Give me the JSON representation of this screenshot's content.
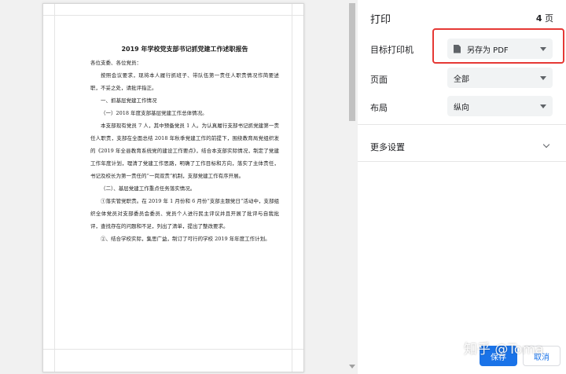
{
  "preview": {
    "document": {
      "title": "2019 年学校党支部书记抓党建工作述职报告",
      "paragraphs": [
        "各位支委、各位党员：",
        "按照会议要求，现将本人履行抓班子、带队伍第一责任人职责情况作简要述职，不妥之处，请批评指正。",
        "一、抓基层党建工作情况",
        "（一）2018 年度支部基层党建工作总体情况。",
        "本支部现有党员 7 人，其中预备党员 1 人。为认真履行支部书记抓党建第一责任人职责，支部在全面总结 2018 年秋季党建工作的前提下，围绕教育局党组织发的《2019 年全县教育系统党的建设工作要点》，结合本支部实际情况，制定了党建工作年度计划，理清了党建工作思路，明确了工作目标和方向，落实了主体责任，书记及校长为第一责任的“一岗双责”机制，支部党建工作有序开展。",
        "（二）、基层党建工作重点任务落实情况。",
        "①落实管党职责。在 2019 年 1 月份和 6 月份“支部主题党日”活动中，支部组织全体党员对支部委员会委员、党员个人进行民主评议并且开展了批评与自我批评，查找存在的问题和不足，列出了清单，提出了整改要求。",
        "②、结合学校实际，集思广益，制订了可行的学校 2019 年年度工作计划。"
      ]
    }
  },
  "sidebar": {
    "title": "打印",
    "page_count": "4",
    "page_unit": "页",
    "destination": {
      "label": "目标打印机",
      "value": "另存为 PDF"
    },
    "pages": {
      "label": "页面",
      "value": "全部"
    },
    "layout": {
      "label": "布局",
      "value": "纵向"
    },
    "more_settings": "更多设置",
    "save_button": "保存",
    "cancel_button": "取消"
  },
  "watermark": "知乎 @Toma",
  "colors": {
    "accent": "#1a73e8",
    "highlight_border": "#e53935",
    "select_bg": "#f1f3f4"
  },
  "icons": {
    "destination": "pdf-file-icon",
    "dropdown": "caret-down-icon",
    "more_settings": "chevron-down-icon"
  }
}
